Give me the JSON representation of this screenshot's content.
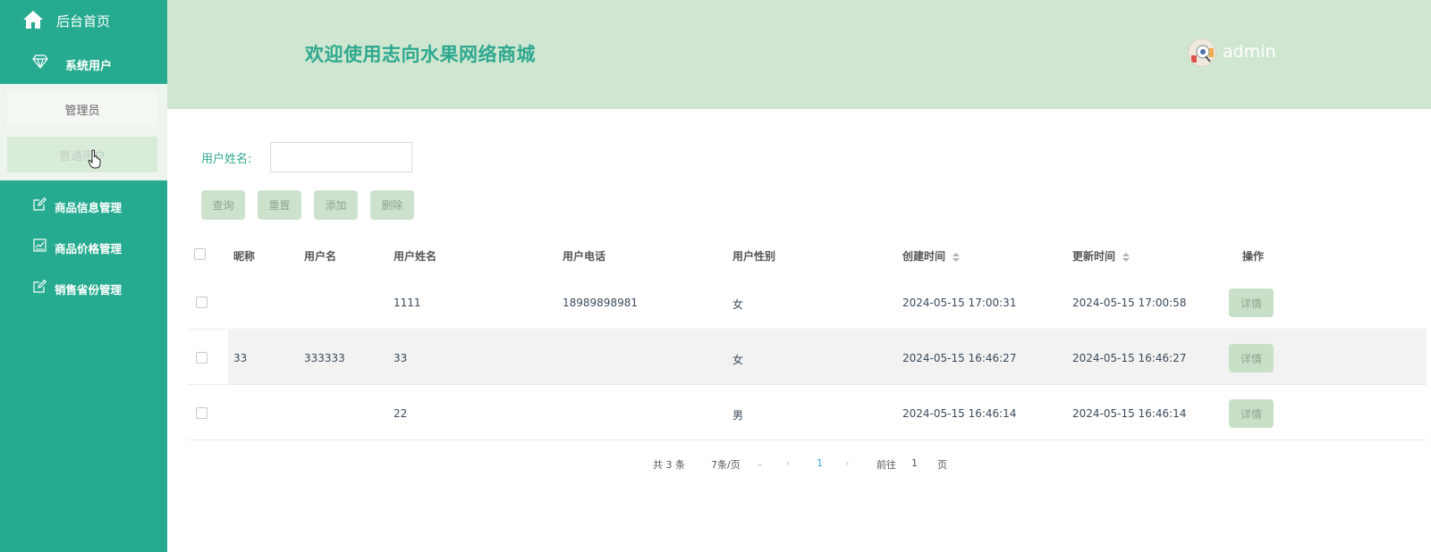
{
  "sidebar": {
    "home_label": "后台首页",
    "group_label": "系统用户",
    "sub_items": [
      {
        "label": "管理员"
      },
      {
        "label": "普通用户"
      }
    ],
    "menu_items": [
      {
        "label": "商品信息管理",
        "icon": "edit-icon"
      },
      {
        "label": "商品价格管理",
        "icon": "chart-icon"
      },
      {
        "label": "销售省份管理",
        "icon": "edit-icon"
      }
    ]
  },
  "header": {
    "title": "欢迎使用志向水果网络商城",
    "user": "admin"
  },
  "search": {
    "label": "用户姓名:",
    "value": ""
  },
  "buttons": {
    "query": "查询",
    "reset": "重置",
    "add": "添加",
    "delete": "删除"
  },
  "table": {
    "headers": {
      "nickname": "昵称",
      "username": "用户名",
      "realname": "用户姓名",
      "phone": "用户电话",
      "gender": "用户性别",
      "created": "创建时间",
      "updated": "更新时间",
      "actions": "操作"
    },
    "rows": [
      {
        "nickname": "",
        "username": "",
        "realname": "1111",
        "phone": "18989898981",
        "gender": "女",
        "created": "2024-05-15 17:00:31",
        "updated": "2024-05-15 17:00:58",
        "action": "详情"
      },
      {
        "nickname": "33",
        "username": "333333",
        "realname": "33",
        "phone": "",
        "gender": "女",
        "created": "2024-05-15 16:46:27",
        "updated": "2024-05-15 16:46:27",
        "action": "详情"
      },
      {
        "nickname": "",
        "username": "",
        "realname": "22",
        "phone": "",
        "gender": "男",
        "created": "2024-05-15 16:46:14",
        "updated": "2024-05-15 16:46:14",
        "action": "详情"
      }
    ]
  },
  "pagination": {
    "total": "共 3 条",
    "page_size": "7条/页",
    "current": "1",
    "goto_label": "前往",
    "goto_value": "1",
    "page_suffix": "页"
  },
  "colors": {
    "sidebar": "#26ab90",
    "header": "#cfe7d0",
    "accent": "#2ea88f"
  }
}
